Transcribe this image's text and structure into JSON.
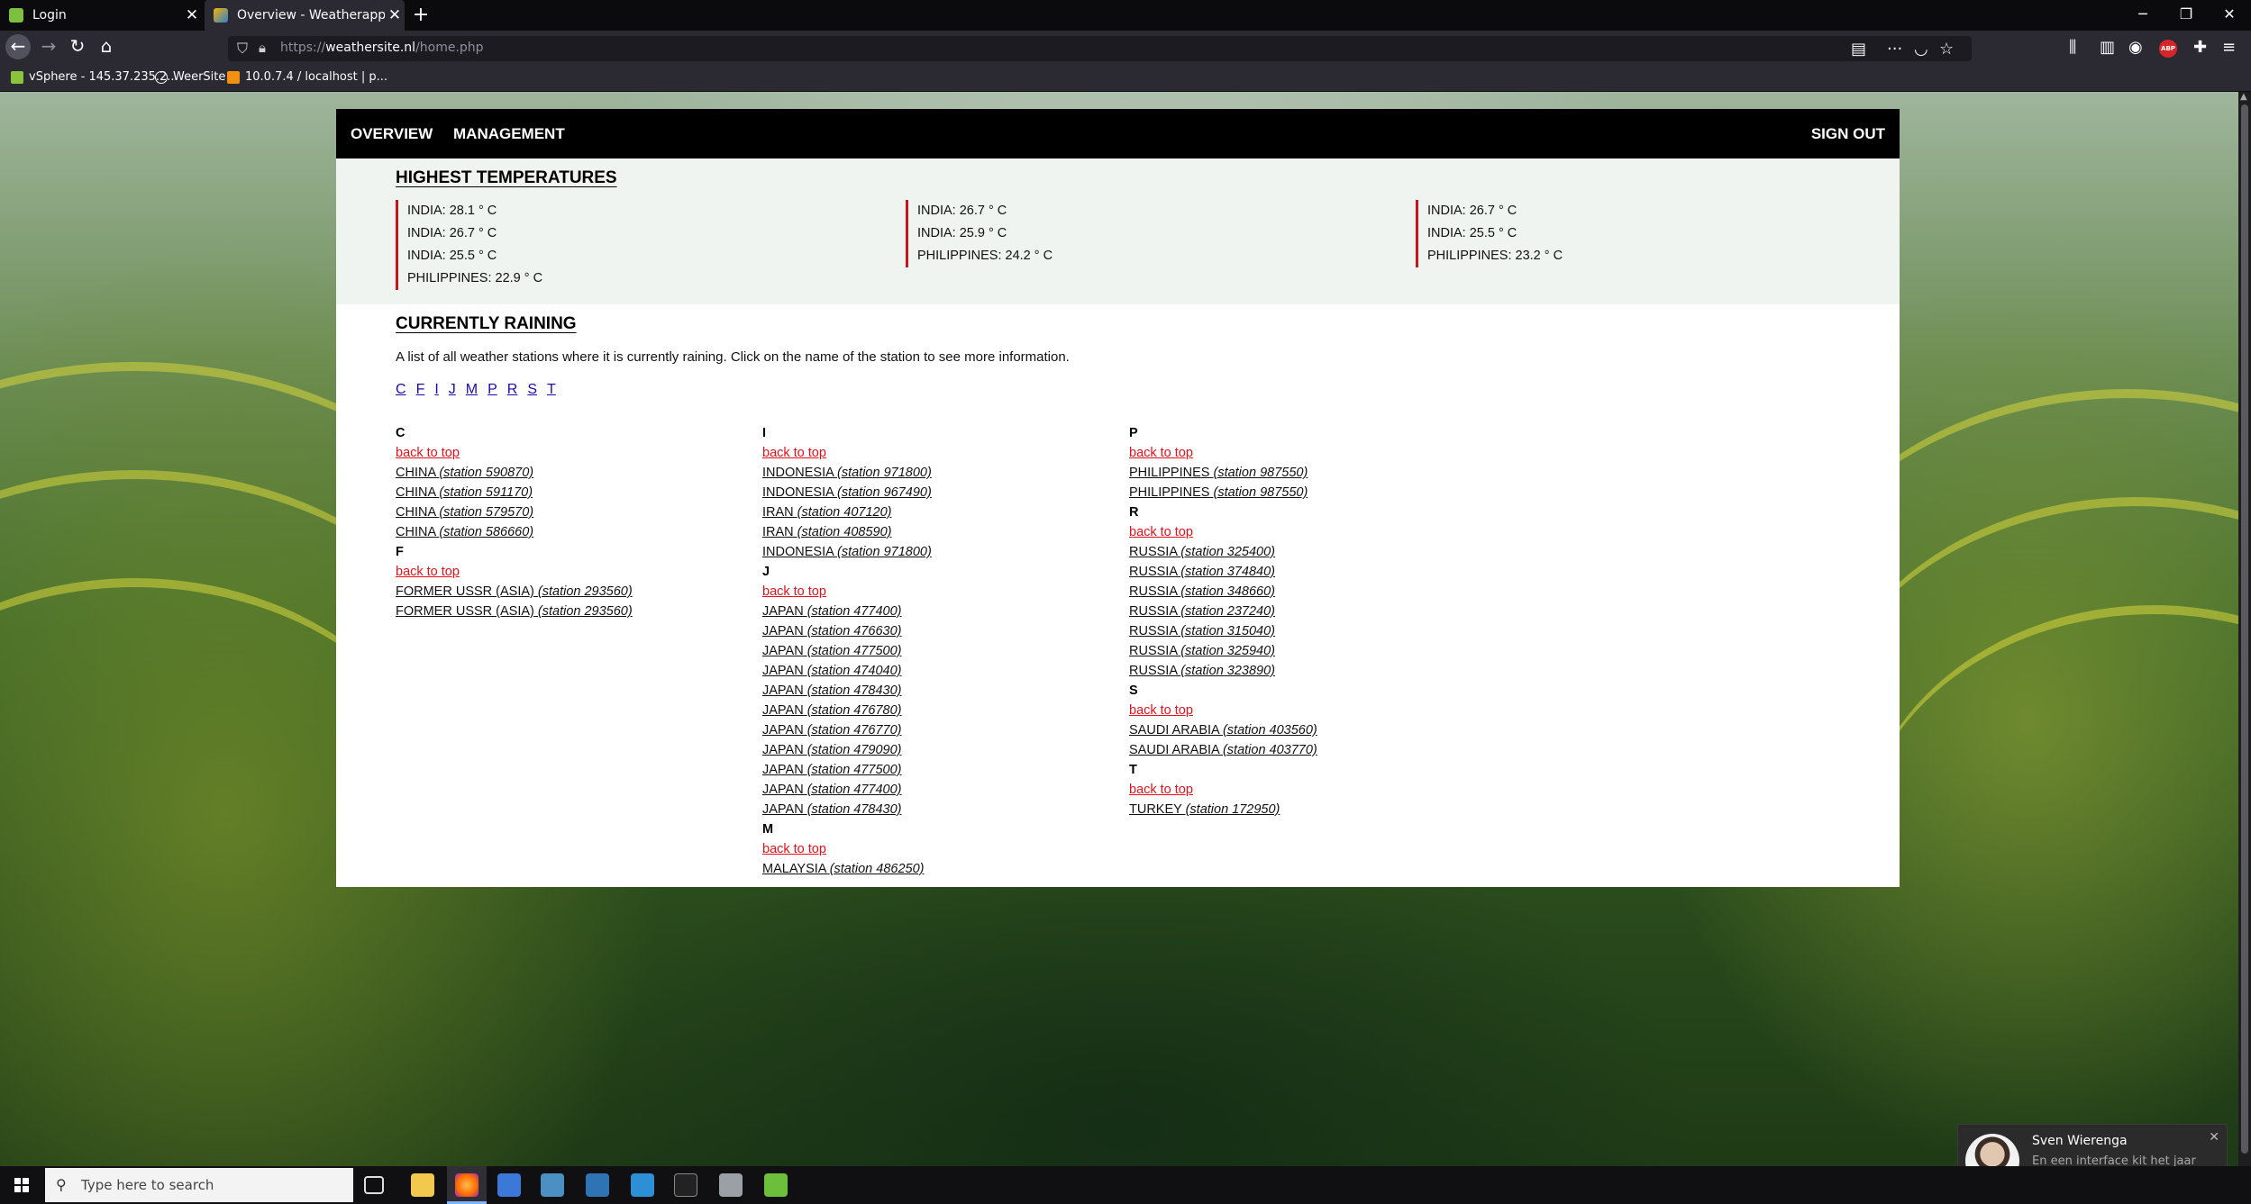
{
  "browser": {
    "tabs": [
      {
        "title": "Login",
        "active": false
      },
      {
        "title": "Overview - Weatherapp Hero C",
        "active": true
      }
    ],
    "url_prefix": "https://",
    "url_host": "weathersite.nl",
    "url_path": "/home.php",
    "bookmarks": [
      "vSphere - 145.37.235.2...",
      "WeerSite",
      "10.0.7.4 / localhost | p..."
    ]
  },
  "site": {
    "nav": {
      "overview": "OVERVIEW",
      "management": "MANAGEMENT",
      "sign_out": "SIGN OUT"
    },
    "highest": {
      "title": "HIGHEST TEMPERATURES",
      "columns": [
        [
          "INDIA: 28.1 ° C",
          "INDIA: 26.7 ° C",
          "INDIA: 25.5 ° C",
          "PHILIPPINES: 22.9 ° C"
        ],
        [
          "INDIA: 26.7 ° C",
          "INDIA: 25.9 ° C",
          "PHILIPPINES: 24.2 ° C"
        ],
        [
          "INDIA: 26.7 ° C",
          "INDIA: 25.5 ° C",
          "PHILIPPINES: 23.2 ° C"
        ]
      ]
    },
    "raining": {
      "title": "CURRENTLY RAINING",
      "intro": "A list of all weather stations where it is currently raining. Click on the name of the station to see more information.",
      "letters": [
        "C",
        "F",
        "I",
        "J",
        "M",
        "P",
        "R",
        "S",
        "T"
      ],
      "back_label": "back to top",
      "columns": [
        [
          {
            "letter": "C",
            "stations": [
              [
                "CHINA",
                "(station 590870)"
              ],
              [
                "CHINA",
                "(station 591170)"
              ],
              [
                "CHINA",
                "(station 579570)"
              ],
              [
                "CHINA",
                "(station 586660)"
              ]
            ]
          },
          {
            "letter": "F",
            "stations": [
              [
                "FORMER USSR (ASIA)",
                "(station 293560)"
              ],
              [
                "FORMER USSR (ASIA)",
                "(station 293560)"
              ]
            ]
          }
        ],
        [
          {
            "letter": "I",
            "stations": [
              [
                "INDONESIA",
                "(station 971800)"
              ],
              [
                "INDONESIA",
                "(station 967490)"
              ],
              [
                "IRAN",
                "(station 407120)"
              ],
              [
                "IRAN",
                "(station 408590)"
              ],
              [
                "INDONESIA",
                "(station 971800)"
              ]
            ]
          },
          {
            "letter": "J",
            "stations": [
              [
                "JAPAN",
                "(station 477400)"
              ],
              [
                "JAPAN",
                "(station 476630)"
              ],
              [
                "JAPAN",
                "(station 477500)"
              ],
              [
                "JAPAN",
                "(station 474040)"
              ],
              [
                "JAPAN",
                "(station 478430)"
              ],
              [
                "JAPAN",
                "(station 476780)"
              ],
              [
                "JAPAN",
                "(station 476770)"
              ],
              [
                "JAPAN",
                "(station 479090)"
              ],
              [
                "JAPAN",
                "(station 477500)"
              ],
              [
                "JAPAN",
                "(station 477400)"
              ],
              [
                "JAPAN",
                "(station 478430)"
              ]
            ]
          },
          {
            "letter": "M",
            "stations": [
              [
                "MALAYSIA",
                "(station 486250)"
              ]
            ]
          }
        ],
        [
          {
            "letter": "P",
            "stations": [
              [
                "PHILIPPINES",
                "(station 987550)"
              ],
              [
                "PHILIPPINES",
                "(station 987550)"
              ]
            ]
          },
          {
            "letter": "R",
            "stations": [
              [
                "RUSSIA",
                "(station 325400)"
              ],
              [
                "RUSSIA",
                "(station 374840)"
              ],
              [
                "RUSSIA",
                "(station 348660)"
              ],
              [
                "RUSSIA",
                "(station 237240)"
              ],
              [
                "RUSSIA",
                "(station 315040)"
              ],
              [
                "RUSSIA",
                "(station 325940)"
              ],
              [
                "RUSSIA",
                "(station 323890)"
              ]
            ]
          },
          {
            "letter": "S",
            "stations": [
              [
                "SAUDI ARABIA",
                "(station 403560)"
              ],
              [
                "SAUDI ARABIA",
                "(station 403770)"
              ]
            ]
          },
          {
            "letter": "T",
            "stations": [
              [
                "TURKEY",
                "(station 172950)"
              ]
            ]
          }
        ]
      ]
    }
  },
  "toast": {
    "name": "Sven Wierenga",
    "message": "En een interface kit het jaar nul heeft gemaakt"
  },
  "taskbar": {
    "search_placeholder": "Type here to search"
  },
  "colors": {
    "accent_red": "#c4161c",
    "link_red": "#e8111a",
    "nav_black": "#000000",
    "panel": "#eff4f0"
  }
}
